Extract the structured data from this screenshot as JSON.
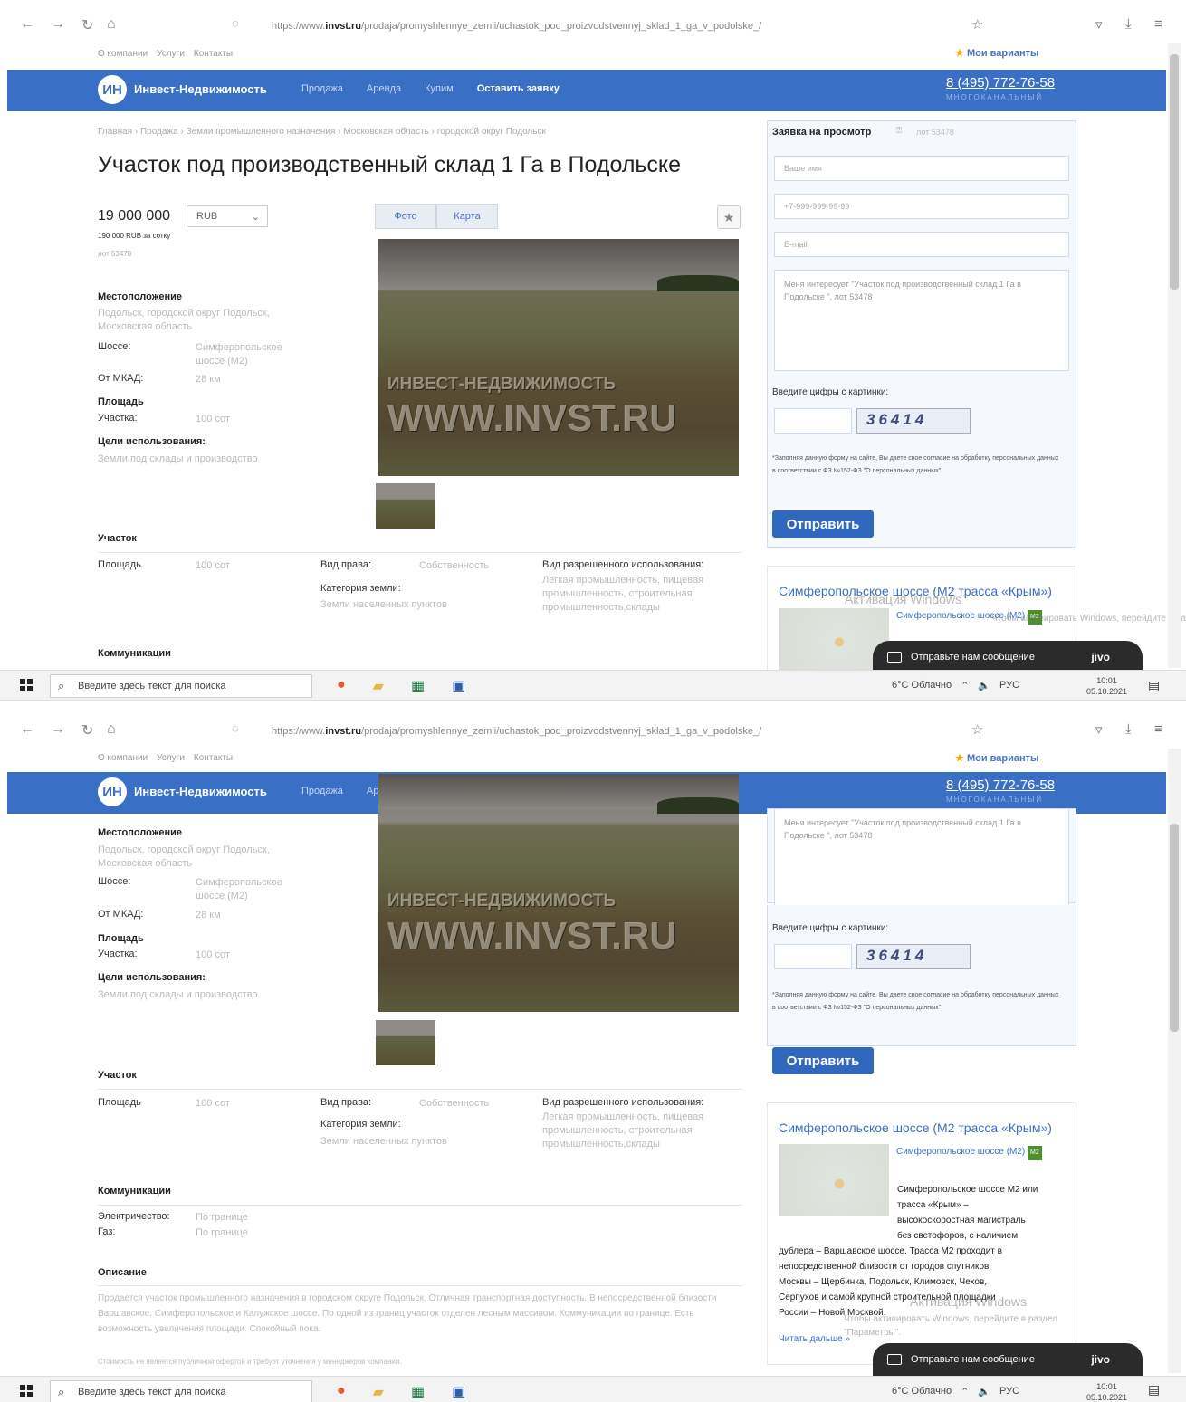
{
  "browser": {
    "url_prefix": "https://www.",
    "url_domain": "invst.ru",
    "url_rest": "/prodaja/promyshlennye_zemli/uchastok_pod_proizvodstvennyj_sklad_1_ga_v_podolske_/"
  },
  "topnav": {
    "about": "О компании",
    "services": "Услуги",
    "contacts": "Контакты",
    "my_variants": "Мои варианты"
  },
  "header": {
    "logo": "ИН",
    "brand": "Инвест-Недвижимость",
    "menu": [
      "Продажа",
      "Аренда",
      "Купим",
      "Оставить заявку"
    ],
    "phone": "8 (495) 772-76-58",
    "phone_sub": "МНОГОКАНАЛЬНЫЙ"
  },
  "breadcrumbs": "Главная › Продажа › Земли промышленного назначения › Московская область › городской округ Подольск",
  "title": "Участок под производственный склад 1 Га в Подольске",
  "price": {
    "value": "19 000 000",
    "currency": "RUB",
    "per_unit": "190 000 RUB за сотку",
    "lot": "лот 53478"
  },
  "media": {
    "tab_photo": "Фото",
    "tab_map": "Карта",
    "watermark1": "ИНВЕСТ-НЕДВИЖИМОСТЬ",
    "watermark2": "WWW.INVST.RU"
  },
  "location": {
    "title": "Местоположение",
    "address": "Подольск, городской округ Подольск, Московская область",
    "highway_label": "Шоссе:",
    "highway": "Симферопольское шоссе (М2)",
    "mkad_label": "От МКАД:",
    "mkad": "28 км"
  },
  "area": {
    "title": "Площадь",
    "plot_label": "Участка:",
    "plot": "100 сот"
  },
  "purpose": {
    "title": "Цели использования:",
    "value": "Земли под склады и производство"
  },
  "plot_section": {
    "title": "Участок",
    "area_label": "Площадь",
    "area": "100 сот",
    "right_label": "Вид права:",
    "right": "Собственность",
    "category_label": "Категория земли:",
    "category": "Земли населенных пунктов",
    "use_label": "Вид разрешенного использования:",
    "use": "Легкая промышленность, пищевая промышленность, строительная промышленность,склады"
  },
  "communications": {
    "title": "Коммуникации",
    "elec_label": "Электричество:",
    "elec": "По границе",
    "gas_label": "Газ:",
    "gas": "По границе"
  },
  "description": {
    "title": "Описание",
    "text": "Продается участок промышленного назначения в городском округе Подольск. Отличная транспортная доступность. В непосредственной близости Варшавское, Симферопольское и Калужское шоссе. По одной из границ участок отделен лесным массивом. Коммуникации по границе. Есть возможность увеличения площади. Спокойный пока.",
    "note": "Стоимость не является публичной офертой и требует уточнения у менеджеров компании."
  },
  "form": {
    "title": "Заявка на просмотр",
    "lot": "лот 53478",
    "name_ph": "Ваше имя",
    "phone_ph": "+7-999-999-99-99",
    "email_ph": "E-mail",
    "message": "Меня интересует \"Участок под производственный склад 1 Га в Подольске \", лот 53478",
    "captcha_label": "Введите цифры с картинки:",
    "captcha": "36414",
    "consent": "*Заполняя данную форму на сайте, Вы даете свое согласие на обработку персональных данных в соответствии с ФЗ №152-ФЗ \"О персональных данных\"",
    "submit": "Отправить"
  },
  "highway_card": {
    "title": "Симферопольское шоссе (М2 трасса «Крым»)",
    "link": "Симферопольское шоссе (М2)",
    "badge": "М2",
    "text1": "Симферопольское шоссе М2 или",
    "text2": "трасса «Крым» –",
    "text3": "высокоскоростная магистраль",
    "text4": "без светофоров, с наличием",
    "text5": "дублера – Варшавское шоссе. Трасса М2 проходит в",
    "text6": "непосредственной близости от городов спутников",
    "text7": "Москвы – Щербинка, Подольск, Климовск, Чехов,",
    "text8": "Серпухов и самой крупной строительной площадки",
    "text9": "России – Новой Москвой.",
    "more": "Читать дальше »"
  },
  "overlay": {
    "activate1": "Активация Windows",
    "activate2": "Чтобы активировать Windows, перейдите в раздел",
    "activate3": "\"Параметры\".",
    "chat": "Отправьте нам сообщение",
    "jivo": "jivo"
  },
  "taskbar": {
    "search": "Введите здесь текст для поиска",
    "weather": "6°C Облачно",
    "lang": "РУС",
    "time": "10:01",
    "date": "05.10.2021"
  }
}
